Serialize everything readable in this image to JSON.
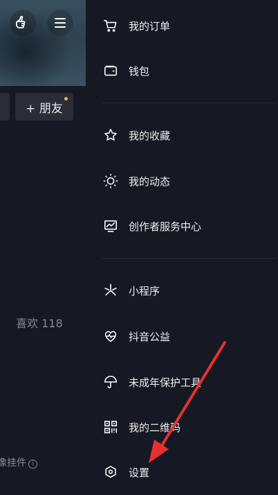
{
  "background": {
    "friend_button_label": "+ 朋友",
    "likes_label": "喜欢 118",
    "widget_label": "像挂件"
  },
  "drawer": {
    "group1": [
      {
        "label": "我的订单",
        "icon": "cart-icon"
      },
      {
        "label": "钱包",
        "icon": "wallet-icon"
      }
    ],
    "group2": [
      {
        "label": "我的收藏",
        "icon": "star-icon"
      },
      {
        "label": "我的动态",
        "icon": "sun-icon"
      },
      {
        "label": "创作者服务中心",
        "icon": "chart-icon"
      }
    ],
    "group3": [
      {
        "label": "小程序",
        "icon": "mini-program-icon"
      },
      {
        "label": "抖音公益",
        "icon": "heart-pulse-icon"
      },
      {
        "label": "未成年保护工具",
        "icon": "umbrella-icon"
      },
      {
        "label": "我的二维码",
        "icon": "qr-code-icon"
      },
      {
        "label": "设置",
        "icon": "settings-icon"
      }
    ]
  },
  "colors": {
    "background": "#161823",
    "text": "#ededee",
    "divider": "#2b2d38",
    "arrow": "#e8312f",
    "notification_dot": "#f6b94a"
  }
}
